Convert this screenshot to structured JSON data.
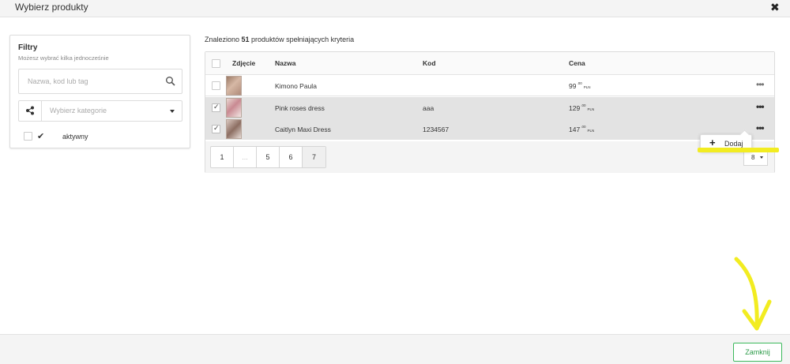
{
  "header": {
    "title": "Wybierz produkty",
    "close_glyph": "✖"
  },
  "filters": {
    "title": "Filtry",
    "subtitle": "Możesz wybrać kilka jednocześnie",
    "search_placeholder": "Nazwa, kod lub tag",
    "category_placeholder": "Wybierz kategorie",
    "active_label": "aktywny",
    "active_checked_glyph": "✔"
  },
  "results": {
    "prefix": "Znaleziono ",
    "count": "51",
    "suffix": " produktów spełniających kryteria"
  },
  "table": {
    "headers": {
      "photo": "Zdjęcie",
      "name": "Nazwa",
      "code": "Kod",
      "price": "Cena"
    },
    "rows": [
      {
        "name": "Kimono Paula",
        "code": "",
        "price_main": "99",
        "price_cents": ".00",
        "currency": "PLN",
        "selected": false
      },
      {
        "name": "Pink roses dress",
        "code": "aaa",
        "price_main": "129",
        "price_cents": ".00",
        "currency": "PLN",
        "selected": true
      },
      {
        "name": "Caitlyn Maxi Dress",
        "code": "1234567",
        "price_main": "147",
        "price_cents": ".00",
        "currency": "PLN",
        "selected": true
      }
    ],
    "row_menu_glyph": "•••"
  },
  "pagination": {
    "pages": [
      "1",
      "...",
      "5",
      "6",
      "7"
    ],
    "current": "7",
    "per_page": "8"
  },
  "popup": {
    "plus_glyph": "+",
    "add_label": "Dodaj"
  },
  "footer": {
    "close_label": "Zamknij"
  },
  "colors": {
    "accent_green": "#3cb95c",
    "highlight_yellow": "#f2ec21",
    "selected_row": "#e3e3e3"
  }
}
